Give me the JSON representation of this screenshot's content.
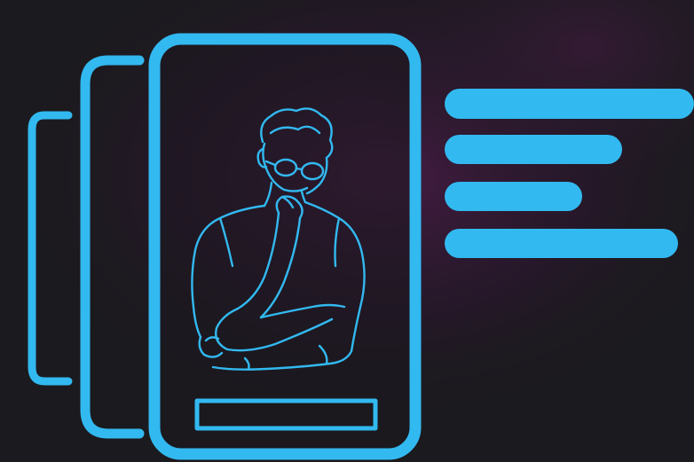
{
  "colors": {
    "accent": "#32b9f0",
    "background": "#1b1a1e",
    "glow": "#4a1c47"
  },
  "icons": {
    "front_card": "profile-card-icon",
    "person": "thinking-person-icon",
    "text_lines": "text-lines-icon"
  }
}
